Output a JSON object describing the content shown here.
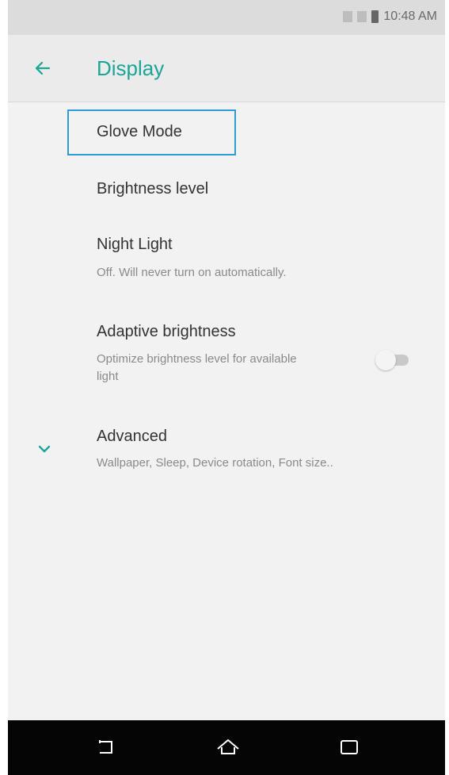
{
  "status_bar": {
    "time": "10:48 AM"
  },
  "app_bar": {
    "title": "Display"
  },
  "settings": {
    "glove_mode": {
      "title": "Glove Mode"
    },
    "brightness_level": {
      "title": "Brightness level"
    },
    "night_light": {
      "title": "Night Light",
      "summary": "Off. Will never turn on automatically."
    },
    "adaptive_brightness": {
      "title": "Adaptive brightness",
      "summary": "Optimize brightness level for available light",
      "enabled": false
    },
    "advanced": {
      "title": "Advanced",
      "summary": "Wallpaper, Sleep, Device rotation, Font size.."
    }
  },
  "colors": {
    "accent": "#1aa596",
    "highlight_border": "#2e9bd6",
    "nav_bar": "#050505"
  },
  "icons": {
    "back": "arrow-left",
    "expand": "chevron-down",
    "nav_back": "back",
    "nav_home": "home",
    "nav_recents": "recents"
  }
}
